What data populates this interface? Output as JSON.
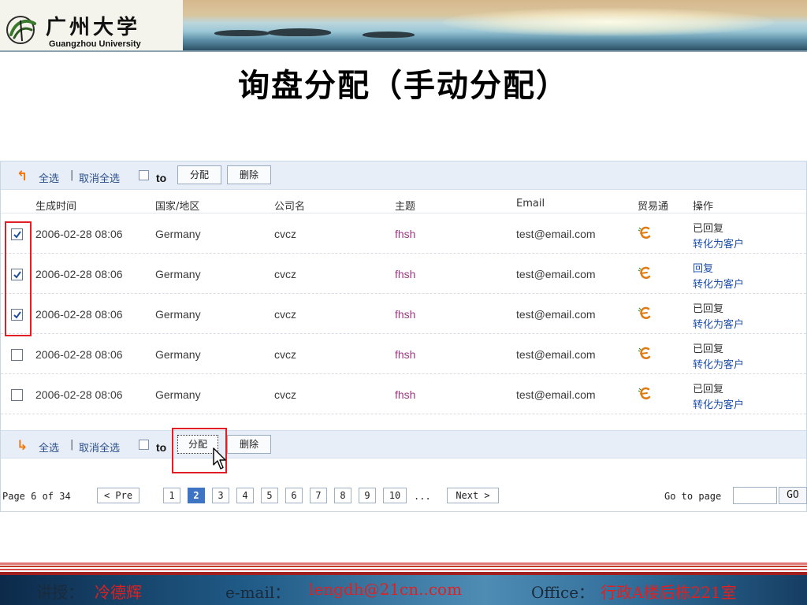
{
  "header": {
    "university_cn": "广州大学",
    "university_en": "Guangzhou University",
    "colors": {
      "banner_sky": "#d9c69f",
      "banner_sea": "#5a8ea6"
    }
  },
  "slide_title": "询盘分配（手动分配）",
  "toolbar": {
    "select_all": "全选",
    "separator": "|",
    "deselect_all": "取消全选",
    "to_label": "to",
    "assign_button": "分配",
    "delete_button": "删除"
  },
  "columns": {
    "created": "生成时间",
    "region": "国家/地区",
    "company": "公司名",
    "subject": "主题",
    "email": "Email",
    "tradeit": "贸易通",
    "action": "操作"
  },
  "rows": [
    {
      "checked": true,
      "created": "2006-02-28 08:06",
      "region": "Germany",
      "company": "cvcz",
      "subject": "fhsh",
      "email": "test@email.com",
      "status": "已回复",
      "status_is_link": false,
      "convert": "转化为客户"
    },
    {
      "checked": true,
      "created": "2006-02-28 08:06",
      "region": "Germany",
      "company": "cvcz",
      "subject": "fhsh",
      "email": "test@email.com",
      "status": "回复",
      "status_is_link": true,
      "convert": "转化为客户"
    },
    {
      "checked": true,
      "created": "2006-02-28 08:06",
      "region": "Germany",
      "company": "cvcz",
      "subject": "fhsh",
      "email": "test@email.com",
      "status": "已回复",
      "status_is_link": false,
      "convert": "转化为客户"
    },
    {
      "checked": false,
      "created": "2006-02-28 08:06",
      "region": "Germany",
      "company": "cvcz",
      "subject": "fhsh",
      "email": "test@email.com",
      "status": "已回复",
      "status_is_link": false,
      "convert": "转化为客户"
    },
    {
      "checked": false,
      "created": "2006-02-28 08:06",
      "region": "Germany",
      "company": "cvcz",
      "subject": "fhsh",
      "email": "test@email.com",
      "status": "已回复",
      "status_is_link": false,
      "convert": "转化为客户"
    }
  ],
  "pager": {
    "info": "Page 6 of 34",
    "prev": "< Pre",
    "pages": [
      "1",
      "2",
      "3",
      "4",
      "5",
      "6",
      "7",
      "8",
      "9",
      "10"
    ],
    "active_page": "2",
    "ellipsis": "...",
    "next": "Next >",
    "goto_label": "Go to page",
    "goto_value": "",
    "go_button": "GO"
  },
  "footer": {
    "lecturer_label": "讲授：",
    "lecturer_name": "冷德辉",
    "email_label": "e-mail：",
    "email_value": "lengdh@21cn..com",
    "office_label": "Office：",
    "office_value": "行政A楼后栋221室"
  },
  "colors": {
    "highlight": "#e01e26",
    "link": "#1e4fa8",
    "subject": "#9a3a83",
    "toolbar_bg": "#e7eef7",
    "active_page": "#3f73c4"
  }
}
